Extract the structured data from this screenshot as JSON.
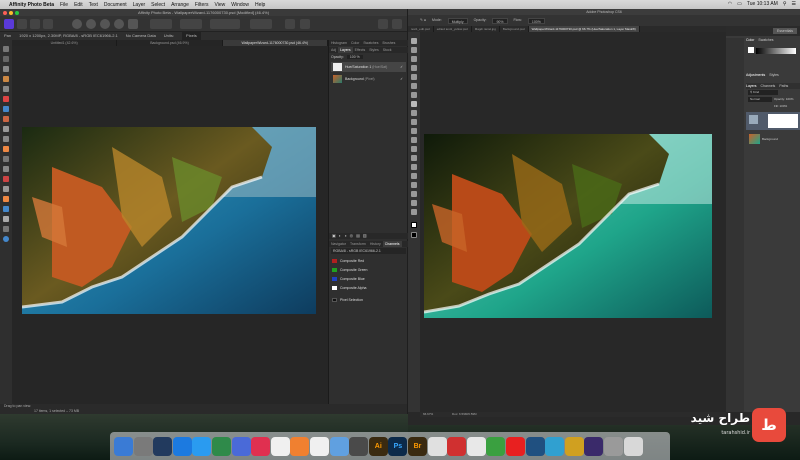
{
  "menubar": {
    "apple_glyph": "",
    "app": "Affinity Photo Beta",
    "items": [
      "File",
      "Edit",
      "Text",
      "Document",
      "Layer",
      "Select",
      "Arrange",
      "Filters",
      "View",
      "Window",
      "Help"
    ],
    "clock": "Tue 10:13 AM"
  },
  "affinity": {
    "title": "Affinity Photo Beta - WallpaperWizard-1176000730.psd [Modified] (46.4%)",
    "context": [
      "Pan",
      "1920 x 1200px, 2.30MP, RGBA/8 - sRGB IEC61966-2.1",
      "No Camera Data",
      "Units:",
      "Pixels"
    ],
    "doc_tabs": [
      "Untitled1 (42.6%)",
      "Background.psd (46.9%)",
      "WallpaperWizard-1176000730.psd (46.4%)"
    ],
    "panel_tabs_top": [
      "Histogram",
      "Color",
      "Swatches",
      "Brushes"
    ],
    "panel_tabs_layers": [
      "Adj",
      "Layers",
      "Effects",
      "Styles",
      "Stock"
    ],
    "opacity_label": "Opacity:",
    "opacity_value": "100 %",
    "layers": [
      {
        "name": "Hue/Saturation 1",
        "kind": "(Hue/Sat)"
      },
      {
        "name": "Background",
        "kind": "(Pixel)"
      }
    ],
    "panel_tabs_channels": [
      "Navigator",
      "Transform",
      "History",
      "Channels"
    ],
    "channels_header": "RGBA/8 - sRGB IEC61966-2.1",
    "channels": [
      {
        "name": "Composite Red",
        "color": "#b02020"
      },
      {
        "name": "Composite Green",
        "color": "#20a020"
      },
      {
        "name": "Composite Blue",
        "color": "#2040c0"
      },
      {
        "name": "Composite Alpha",
        "color": "#ffffff"
      },
      {
        "name": "Pixel Selection",
        "color": "#1a1a1a"
      }
    ],
    "status": "Drag to pan view.",
    "status2": "17 items, 1 selected – 73 MB"
  },
  "photoshop": {
    "title": "Adobe Photoshop CS6",
    "options": [
      "Mode:",
      "Multiply",
      "Opacity:",
      "90%",
      "Flow:",
      "100%"
    ],
    "doc_tabs": [
      "test1_edit.psd",
      "edited test1_yellow.psd",
      "Magdi raniel.jpg",
      "Background.psd",
      "WallpaperWizard-1176000730.psd @ 66.7% (Hue/Saturation 1, Layer Mask/8)"
    ],
    "status": "66.67%",
    "doc": "Doc: 6.59M/6.59M",
    "right_tabs": [
      "Color",
      "Swatches"
    ],
    "adj_tabs": [
      "Adjustments",
      "Styles"
    ],
    "layer_tabs": [
      "Layers",
      "Channels",
      "Paths"
    ],
    "blend": "Normal",
    "opacity": "Opacity: 100%",
    "fill": "Fill: 100%",
    "layers": [
      "",
      "Background"
    ],
    "essentials": "Essentials"
  },
  "dock": {
    "apps": [
      {
        "label": "",
        "color": "#3a7bd5"
      },
      {
        "label": "",
        "color": "#7a7a7a"
      },
      {
        "label": "",
        "color": "#223a5e"
      },
      {
        "label": "",
        "color": "#1c7ae0"
      },
      {
        "label": "",
        "color": "#2a9bf0"
      },
      {
        "label": "",
        "color": "#2f8a4a"
      },
      {
        "label": "",
        "color": "#4a6ad8"
      },
      {
        "label": "",
        "color": "#e03050"
      },
      {
        "label": "",
        "color": "#f0f0f0"
      },
      {
        "label": "",
        "color": "#f08030"
      },
      {
        "label": "",
        "color": "#f0f0f0"
      },
      {
        "label": "",
        "color": "#60a0e0"
      },
      {
        "label": "",
        "color": "#4a4a4a"
      },
      {
        "label": "Ai",
        "color": "#3a2a10"
      },
      {
        "label": "Ps",
        "color": "#0c2a4a"
      },
      {
        "label": "Br",
        "color": "#3a2a10"
      },
      {
        "label": "",
        "color": "#e0e0e0"
      },
      {
        "label": "",
        "color": "#d03030"
      },
      {
        "label": "",
        "color": "#e8e8e8"
      },
      {
        "label": "",
        "color": "#3aa040"
      },
      {
        "label": "",
        "color": "#e82020"
      },
      {
        "label": "",
        "color": "#205080"
      },
      {
        "label": "",
        "color": "#30a0d0"
      },
      {
        "label": "",
        "color": "#d0a020"
      },
      {
        "label": "",
        "color": "#3a2a6a"
      },
      {
        "label": "",
        "color": "#9a9a9a"
      },
      {
        "label": "",
        "color": "#d8d8d8"
      }
    ]
  },
  "watermark": {
    "logo": "ط",
    "text": "طراح شید",
    "sub": "tarahshid.ir"
  }
}
